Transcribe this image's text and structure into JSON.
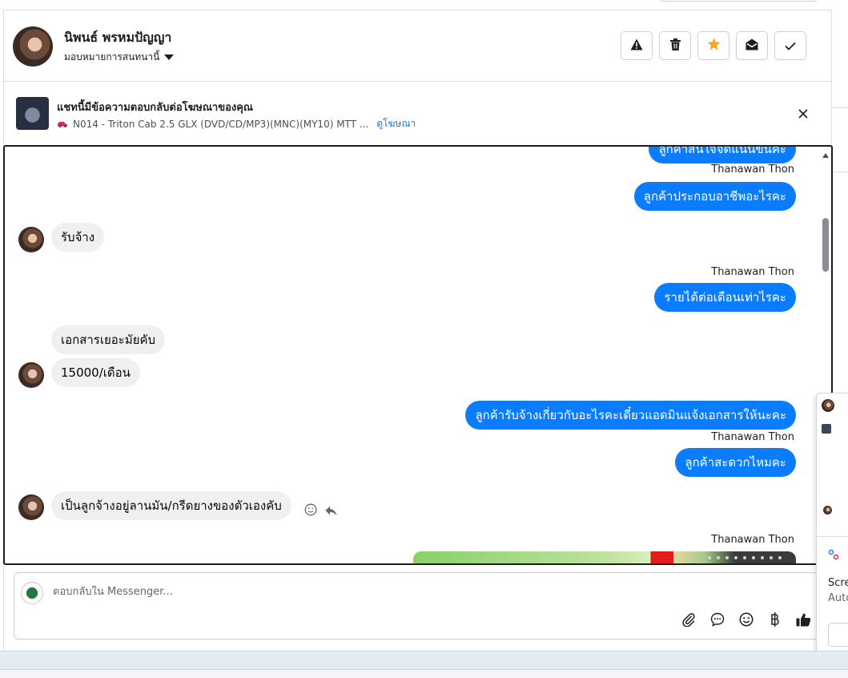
{
  "header": {
    "contact_name": "นิพนธ์ พรหมปัญญา",
    "assign_label": "มอบหมายการสนทนานี้",
    "actions": [
      "spam-alert",
      "delete",
      "star",
      "mark-unread",
      "done"
    ]
  },
  "ad_banner": {
    "title": "แชทนี้มีข้อความตอบกลับต่อโฆษณาของคุณ",
    "product": "N014 - Triton Cab 2.5 GLX (DVD/CD/MP3)(MNC)(MY10) MTT ...",
    "link": "ดูโฆษณา"
  },
  "messages": {
    "partial_top": "ลูกค้าสนใจจัดแน่นขึ้นคะ",
    "sender": "Thanawan Thon",
    "out_1": "ลูกค้าประกอบอาชีพอะไรคะ",
    "in_1": "รับจ้าง",
    "out_2": "รายได้ต่อเดือนเท่าไรคะ",
    "in_2": "เอกสารเยอะมัยคับ",
    "in_3": "15000/เดือน",
    "out_3": "ลูกค้ารับจ้างเกี่ยวกับอะไรคะเดี๋ยวแอดมินแจ้งเอกสารให้นะคะ",
    "out_4": "ลูกค้าสะดวกไหมคะ",
    "in_4": "เป็นลูกจ้างอยู่ลานมัน/กรีดยางของตัวเองคับ"
  },
  "composer": {
    "placeholder": "ตอบกลับใน Messenger..."
  },
  "side_panel": {
    "text_1": "Scre",
    "text_2": "Auto"
  },
  "colors": {
    "outgoing_bubble": "#0a7cff",
    "incoming_bubble": "#f0f0f0",
    "star": "#f5a623",
    "link": "#1877f2"
  }
}
